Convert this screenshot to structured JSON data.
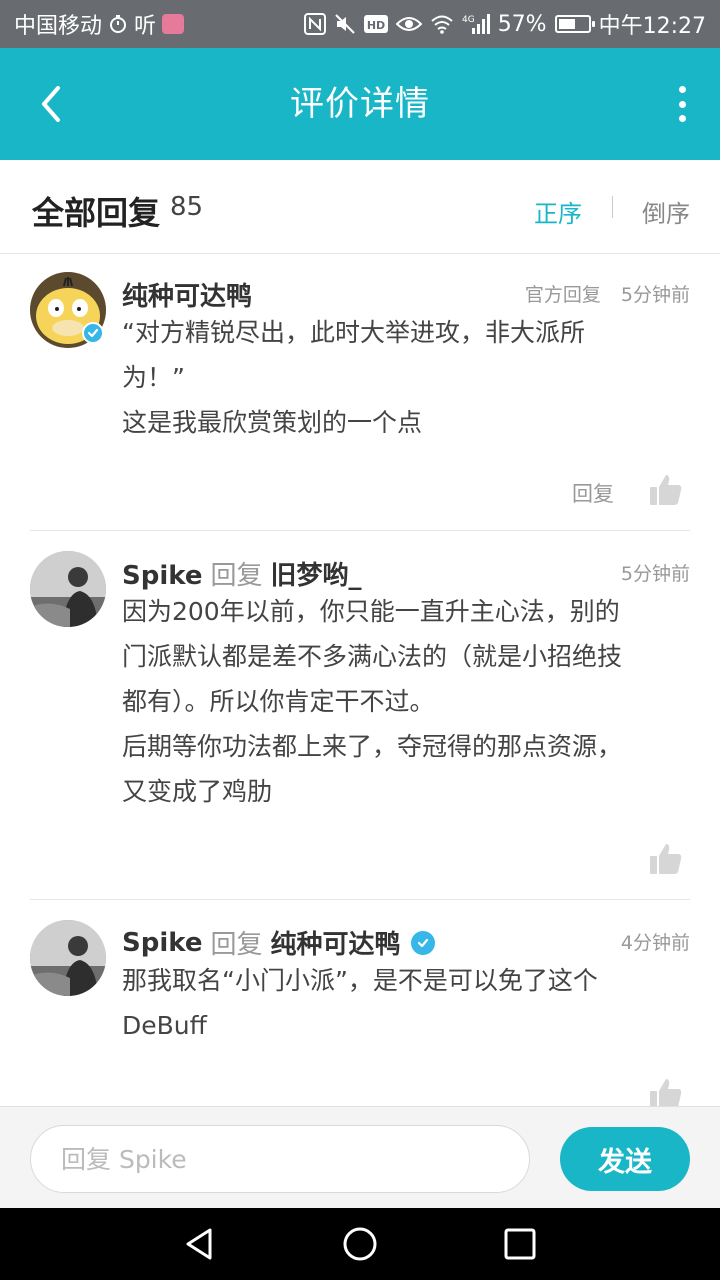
{
  "status_bar": {
    "carrier": "中国移动",
    "app_text": "听",
    "network_type": "4G",
    "battery": "57%",
    "battery_level": 0.57,
    "time": "中午12:27"
  },
  "navbar": {
    "title": "评价详情"
  },
  "header": {
    "title": "全部回复",
    "count": "85",
    "sort_asc": "正序",
    "sort_desc": "倒序",
    "active_sort": "正序"
  },
  "comments": [
    {
      "author": "纯种可达鸭",
      "verified": true,
      "badge": "官方回复",
      "time": "5分钟前",
      "lines": [
        "“对方精锐尽出，此时大举进攻，非大派所",
        "为！”",
        "这是我最欣赏策划的一个点"
      ],
      "reply_label": "回复"
    },
    {
      "author": "Spike",
      "reply_word": "回复",
      "reply_to": "旧梦哟_",
      "time": "5分钟前",
      "lines": [
        "因为200年以前，你只能一直升主心法，别的",
        "门派默认都是差不多满心法的（就是小招绝技",
        "都有）。所以你肯定干不过。",
        "后期等你功法都上来了，夺冠得的那点资源，",
        "又变成了鸡肋"
      ]
    },
    {
      "author": "Spike",
      "reply_word": "回复",
      "reply_to": "纯种可达鸭",
      "reply_to_verified": true,
      "time": "4分钟前",
      "lines": [
        "那我取名“小门小派”，是不是可以免了这个",
        "DeBuff"
      ]
    }
  ],
  "input": {
    "placeholder": "回复 Spike",
    "value": "",
    "send_label": "发送"
  },
  "colors": {
    "accent": "#19b6c8",
    "status_bar": "#686c70",
    "verified": "#37b7e8"
  }
}
